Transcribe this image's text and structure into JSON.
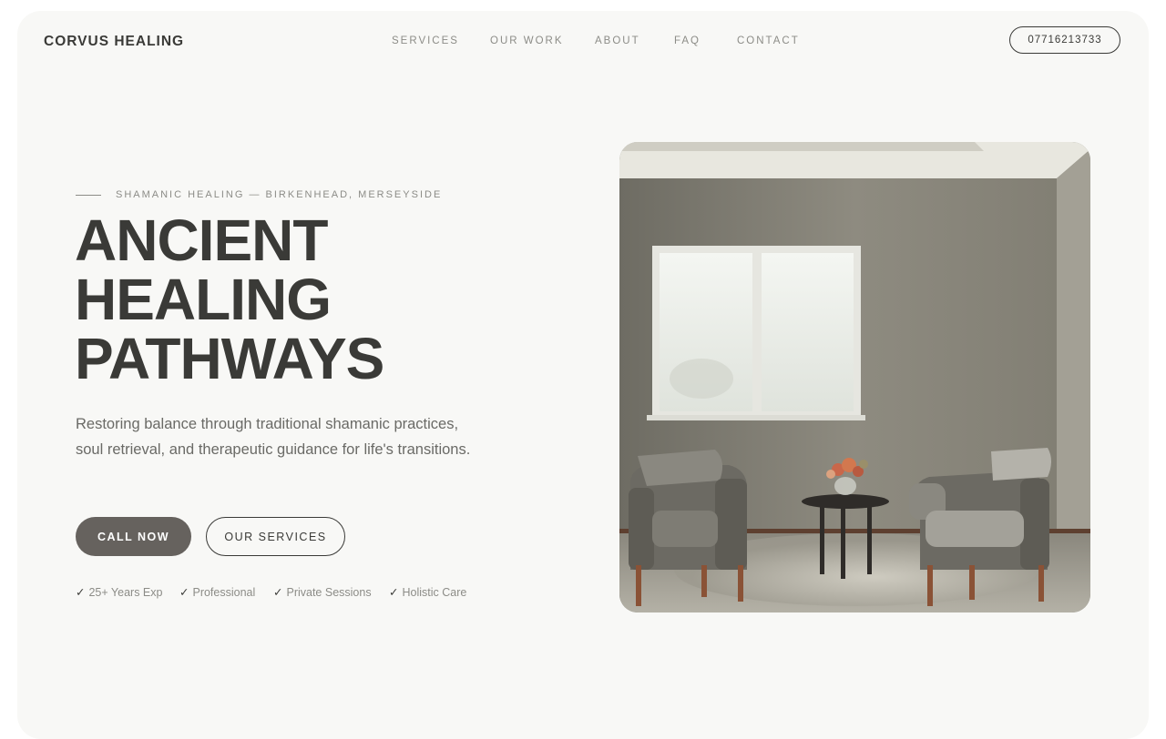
{
  "header": {
    "brand": "CORVUS HEALING",
    "nav": [
      "SERVICES",
      "OUR WORK",
      "ABOUT",
      "FAQ",
      "CONTACT"
    ],
    "phone": "07716213733"
  },
  "hero": {
    "eyebrow": "SHAMANIC HEALING — BIRKENHEAD, MERSEYSIDE",
    "headline": [
      "ANCIENT",
      "HEALING",
      "PATHWAYS"
    ],
    "description": "Restoring balance through traditional shamanic practices, soul retrieval, and therapeutic guidance for life's transitions.",
    "buttons": {
      "primary": "CALL NOW",
      "secondary": "OUR SERVICES"
    },
    "features": [
      "25+ Years Exp",
      "Professional",
      "Private Sessions",
      "Holistic Care"
    ],
    "check_icon": "✓"
  },
  "colors": {
    "background": "#f8f8f6",
    "text": "#3a3a37",
    "muted": "#8c8c87",
    "button": "#66625e"
  }
}
